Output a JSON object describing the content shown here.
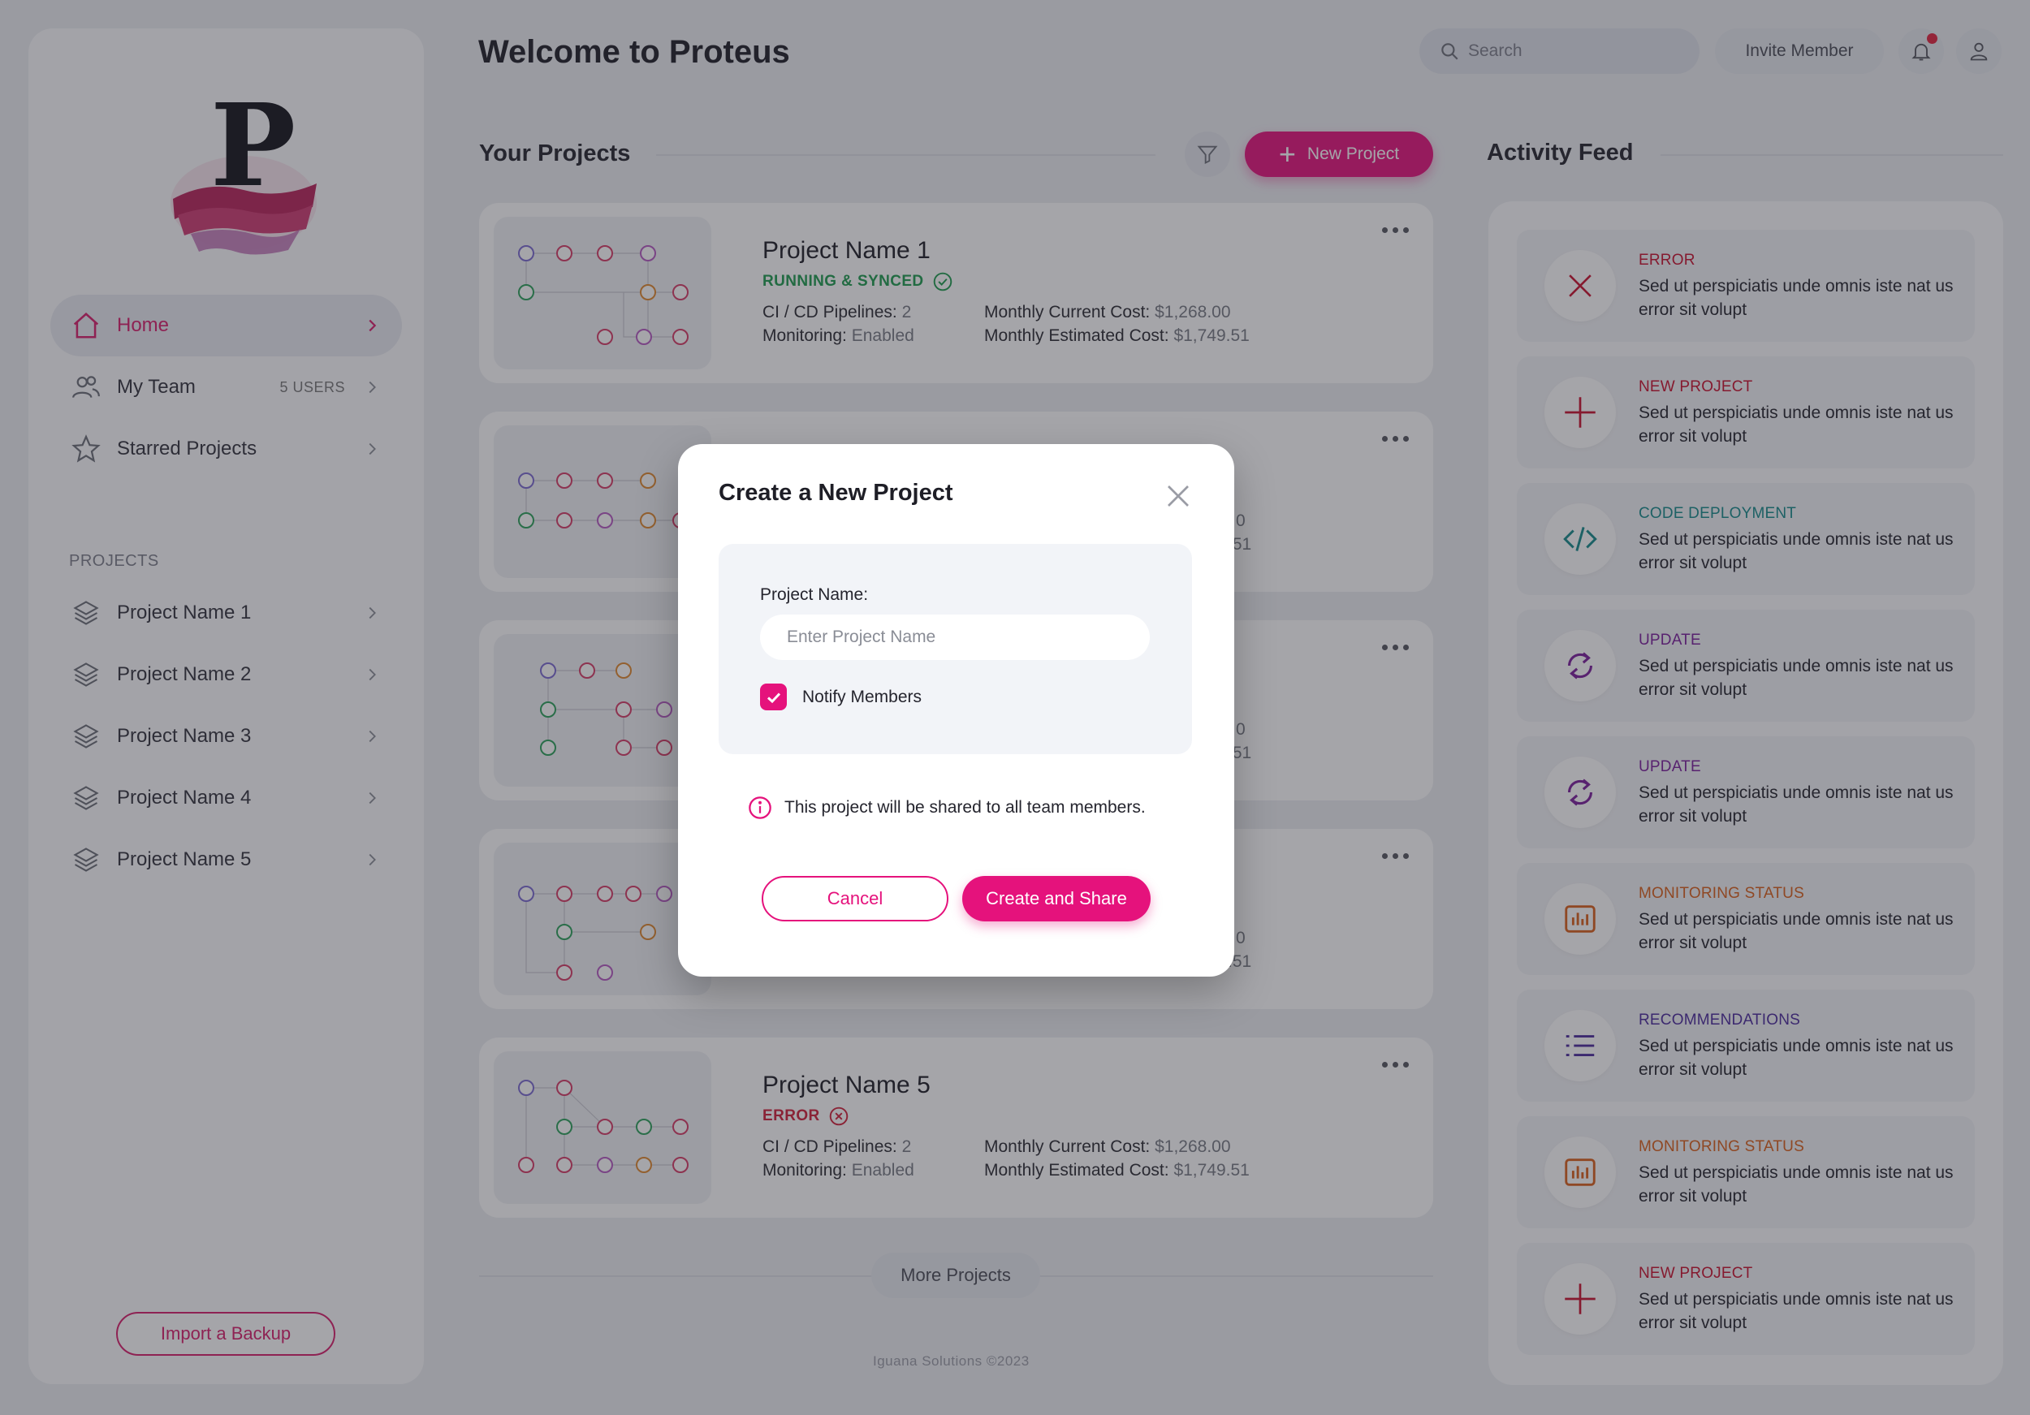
{
  "header": {
    "title": "Welcome to Proteus",
    "search_placeholder": "Search",
    "invite_label": "Invite Member"
  },
  "sidebar": {
    "nav": [
      {
        "label": "Home",
        "extra": "",
        "icon": "home-icon"
      },
      {
        "label": "My Team",
        "extra": "5 USERS",
        "icon": "team-icon"
      },
      {
        "label": "Starred Projects",
        "extra": "",
        "icon": "star-icon"
      }
    ],
    "projects_heading": "PROJECTS",
    "projects": [
      {
        "label": "Project Name 1"
      },
      {
        "label": "Project Name 2"
      },
      {
        "label": "Project Name 3"
      },
      {
        "label": "Project Name 4"
      },
      {
        "label": "Project Name 5"
      }
    ],
    "import_label": "Import a Backup"
  },
  "projects_section": {
    "title": "Your Projects",
    "new_label": "New Project",
    "cards": [
      {
        "name": "Project Name 1",
        "status": "RUNNING & SYNCED",
        "status_color": "#1e9b4f",
        "pipelines_label": "CI / CD Pipelines:",
        "pipelines": "2",
        "monitoring_label": "Monitoring:",
        "monitoring": "Enabled",
        "current_cost_label": "Monthly Current Cost:",
        "current_cost": "$1,268.00",
        "estimated_cost_label": "Monthly Estimated Cost:",
        "estimated_cost": "$1,749.51"
      },
      {
        "name": "",
        "status": "",
        "status_color": "#1e9b4f",
        "pipelines_label": "",
        "pipelines": "",
        "monitoring_label": "",
        "monitoring": "",
        "current_cost_label": "",
        "current_cost": "0",
        "estimated_cost_label": "",
        "estimated_cost": ".51"
      },
      {
        "name": "",
        "status": "",
        "status_color": "#1e9b4f",
        "pipelines_label": "",
        "pipelines": "",
        "monitoring_label": "",
        "monitoring": "",
        "current_cost_label": "",
        "current_cost": "0",
        "estimated_cost_label": "",
        "estimated_cost": ".51"
      },
      {
        "name": "",
        "status": "",
        "status_color": "#1e9b4f",
        "pipelines_label": "",
        "pipelines": "",
        "monitoring_label": "",
        "monitoring": "",
        "current_cost_label": "",
        "current_cost": "0",
        "estimated_cost_label": "",
        "estimated_cost": ".51"
      },
      {
        "name": "Project Name 5",
        "status": "ERROR",
        "status_color": "#d11f3a",
        "pipelines_label": "CI / CD Pipelines:",
        "pipelines": "2",
        "monitoring_label": "Monitoring:",
        "monitoring": "Enabled",
        "current_cost_label": "Monthly Current Cost:",
        "current_cost": "$1,268.00",
        "estimated_cost_label": "Monthly Estimated Cost:",
        "estimated_cost": "$1,749.51"
      }
    ],
    "more_label": "More Projects",
    "footer": "Iguana Solutions ©2023"
  },
  "activity": {
    "title": "Activity Feed",
    "items": [
      {
        "type": "ERROR",
        "color": "#c8102e",
        "icon": "error-x-icon",
        "desc": "Sed ut perspiciatis unde omnis iste nat us error sit volupt"
      },
      {
        "type": "NEW PROJECT",
        "color": "#c8102e",
        "icon": "plus-icon",
        "desc": "Sed ut perspiciatis unde omnis iste nat us error sit volupt"
      },
      {
        "type": "CODE DEPLOYMENT",
        "color": "#158a8a",
        "icon": "code-icon",
        "desc": "Sed ut perspiciatis unde omnis iste nat us error sit volupt"
      },
      {
        "type": "UPDATE",
        "color": "#7a1e9c",
        "icon": "refresh-icon",
        "desc": "Sed ut perspiciatis unde omnis iste nat us error sit volupt"
      },
      {
        "type": "UPDATE",
        "color": "#7a1e9c",
        "icon": "refresh-icon",
        "desc": "Sed ut perspiciatis unde omnis iste nat us error sit volupt"
      },
      {
        "type": "MONITORING STATUS",
        "color": "#d9601a",
        "icon": "chart-icon",
        "desc": "Sed ut perspiciatis unde omnis iste nat us error sit volupt"
      },
      {
        "type": "RECOMMENDATIONS",
        "color": "#4a2a9c",
        "icon": "list-icon",
        "desc": "Sed ut perspiciatis unde omnis iste nat us error sit volupt"
      },
      {
        "type": "MONITORING STATUS",
        "color": "#d9601a",
        "icon": "chart-icon",
        "desc": "Sed ut perspiciatis unde omnis iste nat us error sit volupt"
      },
      {
        "type": "NEW PROJECT",
        "color": "#c8102e",
        "icon": "plus-icon",
        "desc": "Sed ut perspiciatis unde omnis iste nat us error sit volupt"
      }
    ]
  },
  "modal": {
    "title": "Create a New Project",
    "field_label": "Project Name:",
    "field_placeholder": "Enter Project Name",
    "field_value": "",
    "checkbox_label": "Notify Members",
    "checkbox_checked": true,
    "info": "This project will be shared to all team members.",
    "cancel_label": "Cancel",
    "create_label": "Create and Share"
  },
  "colors": {
    "accent": "#e5127c",
    "success": "#1e9b4f",
    "error": "#d11f3a"
  }
}
